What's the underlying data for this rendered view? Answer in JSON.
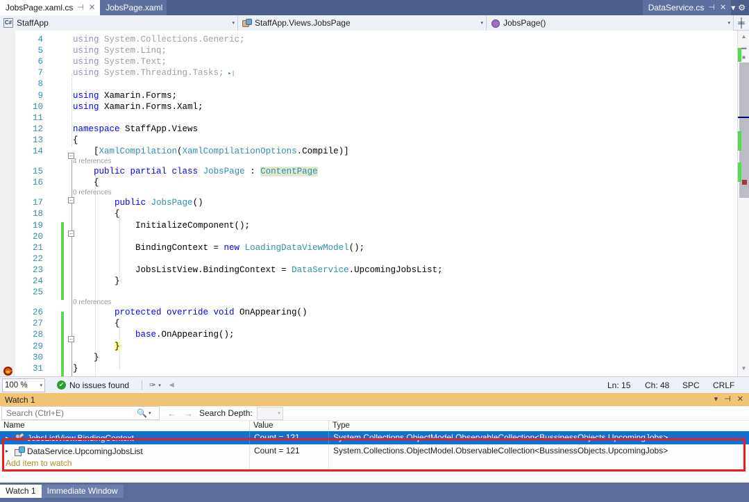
{
  "tabs": {
    "items": [
      {
        "label": "JobsPage.xaml.cs",
        "active": true,
        "pin": "⊣",
        "close": "✕"
      },
      {
        "label": "JobsPage.xaml",
        "active": false
      },
      {
        "label": "DataService.cs",
        "active": false,
        "pin": "⊣",
        "close": "✕"
      }
    ],
    "dropdown_icon": "▾",
    "settings_icon": "⚙"
  },
  "navbar": {
    "project": "StaffApp",
    "project_icon": "C#",
    "type": "StaffApp.Views.JobsPage",
    "member": "JobsPage()",
    "arrow": "▾",
    "split_icon": "╪"
  },
  "editor": {
    "lines": [
      {
        "n": "4",
        "tokens": [
          {
            "t": "using",
            "c": "kw-d"
          },
          {
            "t": " System.Collections.Generic;",
            "c": "txt-d"
          }
        ]
      },
      {
        "n": "5",
        "tokens": [
          {
            "t": "using",
            "c": "kw-d"
          },
          {
            "t": " System.Linq;",
            "c": "txt-d"
          }
        ]
      },
      {
        "n": "6",
        "tokens": [
          {
            "t": "using",
            "c": "kw-d"
          },
          {
            "t": " System.Text;",
            "c": "txt-d"
          }
        ]
      },
      {
        "n": "7",
        "tokens": [
          {
            "t": "using",
            "c": "kw-d"
          },
          {
            "t": " System.Threading.Tasks;",
            "c": "txt-d"
          },
          {
            "t": " ▸|",
            "c": "expand-arrow"
          }
        ]
      },
      {
        "n": "8",
        "tokens": []
      },
      {
        "n": "9",
        "tokens": [
          {
            "t": "using",
            "c": "kw"
          },
          {
            "t": " Xamarin.Forms;",
            "c": "pln"
          }
        ]
      },
      {
        "n": "10",
        "tokens": [
          {
            "t": "using",
            "c": "kw"
          },
          {
            "t": " Xamarin.Forms.Xaml;",
            "c": "pln"
          }
        ]
      },
      {
        "n": "11",
        "tokens": []
      },
      {
        "n": "12",
        "tokens": [
          {
            "t": "namespace",
            "c": "kw"
          },
          {
            "t": " StaffApp.Views",
            "c": "pln"
          }
        ]
      },
      {
        "n": "13",
        "tokens": [
          {
            "t": "{",
            "c": "pln"
          }
        ]
      },
      {
        "n": "14",
        "tokens": [
          {
            "t": "    [",
            "c": "pln"
          },
          {
            "t": "XamlCompilation",
            "c": "typ"
          },
          {
            "t": "(",
            "c": "pln"
          },
          {
            "t": "XamlCompilationOptions",
            "c": "typ"
          },
          {
            "t": ".Compile)]",
            "c": "pln"
          }
        ]
      },
      {
        "n": "15",
        "tokens": [
          {
            "t": "    ",
            "c": "pln"
          },
          {
            "t": "public partial class",
            "c": "kw"
          },
          {
            "t": " ",
            "c": "pln"
          },
          {
            "t": "JobsPage",
            "c": "typ"
          },
          {
            "t": " : ",
            "c": "pln"
          },
          {
            "t": "ContentPage",
            "c": "typ hl-type"
          }
        ]
      },
      {
        "n": "16",
        "tokens": [
          {
            "t": "    {",
            "c": "pln"
          }
        ]
      },
      {
        "n": "17",
        "tokens": [
          {
            "t": "        ",
            "c": "pln"
          },
          {
            "t": "public",
            "c": "kw"
          },
          {
            "t": " ",
            "c": "pln"
          },
          {
            "t": "JobsPage",
            "c": "typ"
          },
          {
            "t": "()",
            "c": "pln"
          }
        ]
      },
      {
        "n": "18",
        "tokens": [
          {
            "t": "        {",
            "c": "pln"
          }
        ]
      },
      {
        "n": "19",
        "tokens": [
          {
            "t": "            InitializeComponent();",
            "c": "pln"
          }
        ]
      },
      {
        "n": "20",
        "tokens": []
      },
      {
        "n": "21",
        "tokens": [
          {
            "t": "            BindingContext = ",
            "c": "pln"
          },
          {
            "t": "new",
            "c": "kw"
          },
          {
            "t": " ",
            "c": "pln"
          },
          {
            "t": "LoadingDataViewModel",
            "c": "typ"
          },
          {
            "t": "();",
            "c": "pln"
          }
        ]
      },
      {
        "n": "22",
        "tokens": []
      },
      {
        "n": "23",
        "tokens": [
          {
            "t": "            JobsListView.BindingContext = ",
            "c": "pln"
          },
          {
            "t": "DataService",
            "c": "typ"
          },
          {
            "t": ".UpcomingJobsList;",
            "c": "pln"
          }
        ]
      },
      {
        "n": "24",
        "tokens": [
          {
            "t": "        }",
            "c": "pln"
          }
        ]
      },
      {
        "n": "25",
        "tokens": []
      },
      {
        "n": "26",
        "tokens": [
          {
            "t": "        ",
            "c": "pln"
          },
          {
            "t": "protected override void",
            "c": "kw"
          },
          {
            "t": " OnAppearing()",
            "c": "pln"
          }
        ]
      },
      {
        "n": "27",
        "tokens": [
          {
            "t": "        {",
            "c": "pln"
          }
        ]
      },
      {
        "n": "28",
        "tokens": [
          {
            "t": "            ",
            "c": "pln"
          },
          {
            "t": "base",
            "c": "kw"
          },
          {
            "t": ".OnAppearing();",
            "c": "pln"
          }
        ]
      },
      {
        "n": "29",
        "tokens": [
          {
            "t": "        ",
            "c": "pln"
          },
          {
            "t": "}",
            "c": "pln hl-brace"
          }
        ]
      },
      {
        "n": "30",
        "tokens": [
          {
            "t": "    }",
            "c": "pln"
          }
        ]
      },
      {
        "n": "31",
        "tokens": [
          {
            "t": "}",
            "c": "pln"
          }
        ]
      }
    ],
    "codelens": [
      {
        "after_line": "14",
        "text": "4 references"
      },
      {
        "after_line": "16",
        "text": "0 references"
      },
      {
        "after_line": "25",
        "text": "0 references"
      }
    ],
    "breakpoint_line": "29"
  },
  "status": {
    "zoom": "100 %",
    "zoom_arrow": "▾",
    "issues": "No issues found",
    "issues_icon": "✔",
    "brush_icon": "🖌",
    "brush_arrow": "▾",
    "grip": "◀",
    "ln": "Ln: 15",
    "ch": "Ch: 48",
    "spc": "SPC",
    "crlf": "CRLF"
  },
  "watch": {
    "title": "Watch 1",
    "controls": {
      "dropdown": "▾",
      "pin": "⊣",
      "close": "✕"
    },
    "search_placeholder": "Search (Ctrl+E)",
    "search_value": "",
    "search_icon": "⌕",
    "search_arrow": "▾",
    "nav_back": "←",
    "nav_forward": "→",
    "depth_label": "Search Depth:",
    "depth_value": "",
    "depth_arrow": "▾",
    "columns": [
      "Name",
      "Value",
      "Type"
    ],
    "rows": [
      {
        "expander": "▸",
        "icon": "wrench-icon",
        "name": "JobsListView.BindingContext",
        "value": "Count = 121",
        "type": "System.Collections.ObjectModel.ObservableCollection<BussinessObjects.UpcomingJobs>",
        "selected": true
      },
      {
        "expander": "▸",
        "icon": "field-icon",
        "name": "DataService.UpcomingJobsList",
        "value": "Count = 121",
        "type": "System.Collections.ObjectModel.ObservableCollection<BussinessObjects.UpcomingJobs>",
        "selected": false
      }
    ],
    "add_item_text": "Add item to watch"
  },
  "bottom_tabs": [
    {
      "label": "Watch 1",
      "active": true
    },
    {
      "label": "Immediate Window",
      "active": false
    }
  ],
  "colors": {
    "chrome": "#5b6c9b",
    "tab_active_bg": "#fdfdfd",
    "watch_title_bg": "#f0c674",
    "row_selected": "#0e70d1",
    "annotation_red": "#ee1c1c",
    "change_bar_green": "#57d957",
    "keyword_blue": "#0000ff",
    "type_teal": "#2b91af"
  }
}
